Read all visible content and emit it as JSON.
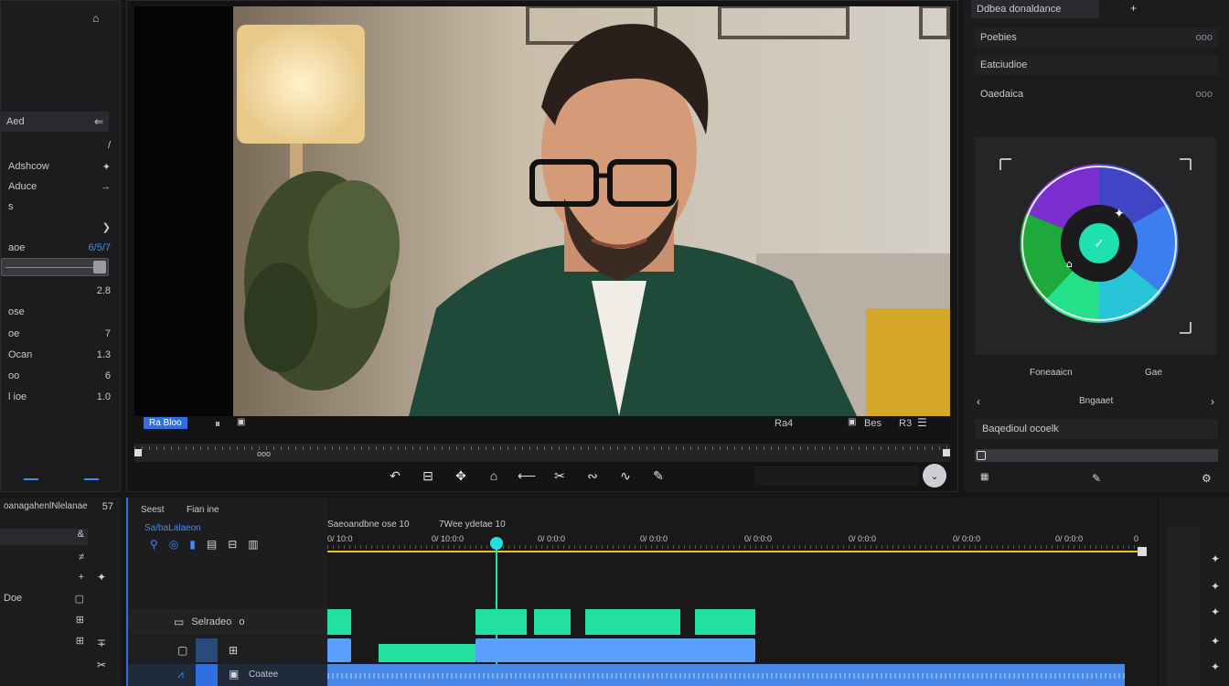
{
  "left_panel": {
    "header_icon": "lock-icon",
    "section_label": "Aed",
    "rows": [
      {
        "label": "",
        "value": "/",
        "icon": "pen-icon"
      },
      {
        "label": "Adshcow",
        "value": "✦",
        "icon": "sparkle-icon"
      },
      {
        "label": "Aduce",
        "value": "→",
        "icon": "arrow-icon"
      },
      {
        "label": "s",
        "value": "",
        "icon": ""
      },
      {
        "label": "",
        "value": "❯",
        "icon": "chevron-icon"
      },
      {
        "label": "aoe",
        "value": "6/5/7",
        "icon": ""
      },
      {
        "label": "",
        "value": "2.8",
        "icon": ""
      },
      {
        "label": "ose",
        "value": "",
        "icon": ""
      },
      {
        "label": "oe",
        "value": "7",
        "icon": ""
      },
      {
        "label": "Ocan",
        "value": "1.3",
        "icon": ""
      },
      {
        "label": "oo",
        "value": "6",
        "icon": ""
      },
      {
        "label": "l ioe",
        "value": "1.0",
        "icon": ""
      }
    ]
  },
  "viewer": {
    "badge": "Ra Bloo",
    "timecode_right": "Ra4",
    "zoom_label": "Bes",
    "zoom_value": "R3",
    "scrub_label": "ooo"
  },
  "viewer_tools": [
    "undo-icon",
    "crop-icon",
    "transform-icon",
    "mask-icon",
    "ripple-icon",
    "cut-icon",
    "slip-icon",
    "link-icon",
    "paint-icon"
  ],
  "right_panel": {
    "tab_title": "Ddbea donaldance",
    "add_label": "+",
    "items": [
      {
        "label": "Poebies",
        "value": "ooo"
      },
      {
        "label": "Eatciudioe"
      },
      {
        "label": "Oaedaica",
        "value": "ooo"
      }
    ],
    "wheel_left_label": "Foneaaicn",
    "wheel_right_label": "Gae",
    "nav_label": "Bngaaet",
    "dropdown_label": "Baqedioul ocoelk"
  },
  "timeline": {
    "left_header": "oanagahenlNlelanae",
    "left_header_value": "57",
    "track_header_a": "Seest",
    "track_header_b": "Fian ine",
    "track_name": "Sa/baLalaeon",
    "audio_label": "Selradeo",
    "audio_value": "o",
    "video_label": "Coatee",
    "ruler_title": "Saeoandbne ose 10",
    "ruler_title_b": "7Wee ydetae 10",
    "ticks": [
      "0/ 10:0",
      "0/ 10:0:0",
      "0/ 0:0:0",
      "0/ 0:0:0",
      "0/ 0:0:0",
      "0/ 0:0:0",
      "0/ 0:0:0",
      "0/ 0:0:0",
      "0"
    ],
    "left_rows": [
      {
        "label": "",
        "value": "&"
      },
      {
        "label": "",
        "value": "≠"
      },
      {
        "label": "",
        "value": "+"
      },
      {
        "label": "Doe",
        "value": "▢"
      },
      {
        "label": "",
        "value": "⊞"
      },
      {
        "label": "",
        "value": "⊞"
      }
    ]
  },
  "colors": {
    "accent": "#3b8cff",
    "playhead": "#22e0e0",
    "waveform": "#22e0a2",
    "audio_clip": "#5aa0ff",
    "timeline_yellow": "#e6c21a"
  }
}
